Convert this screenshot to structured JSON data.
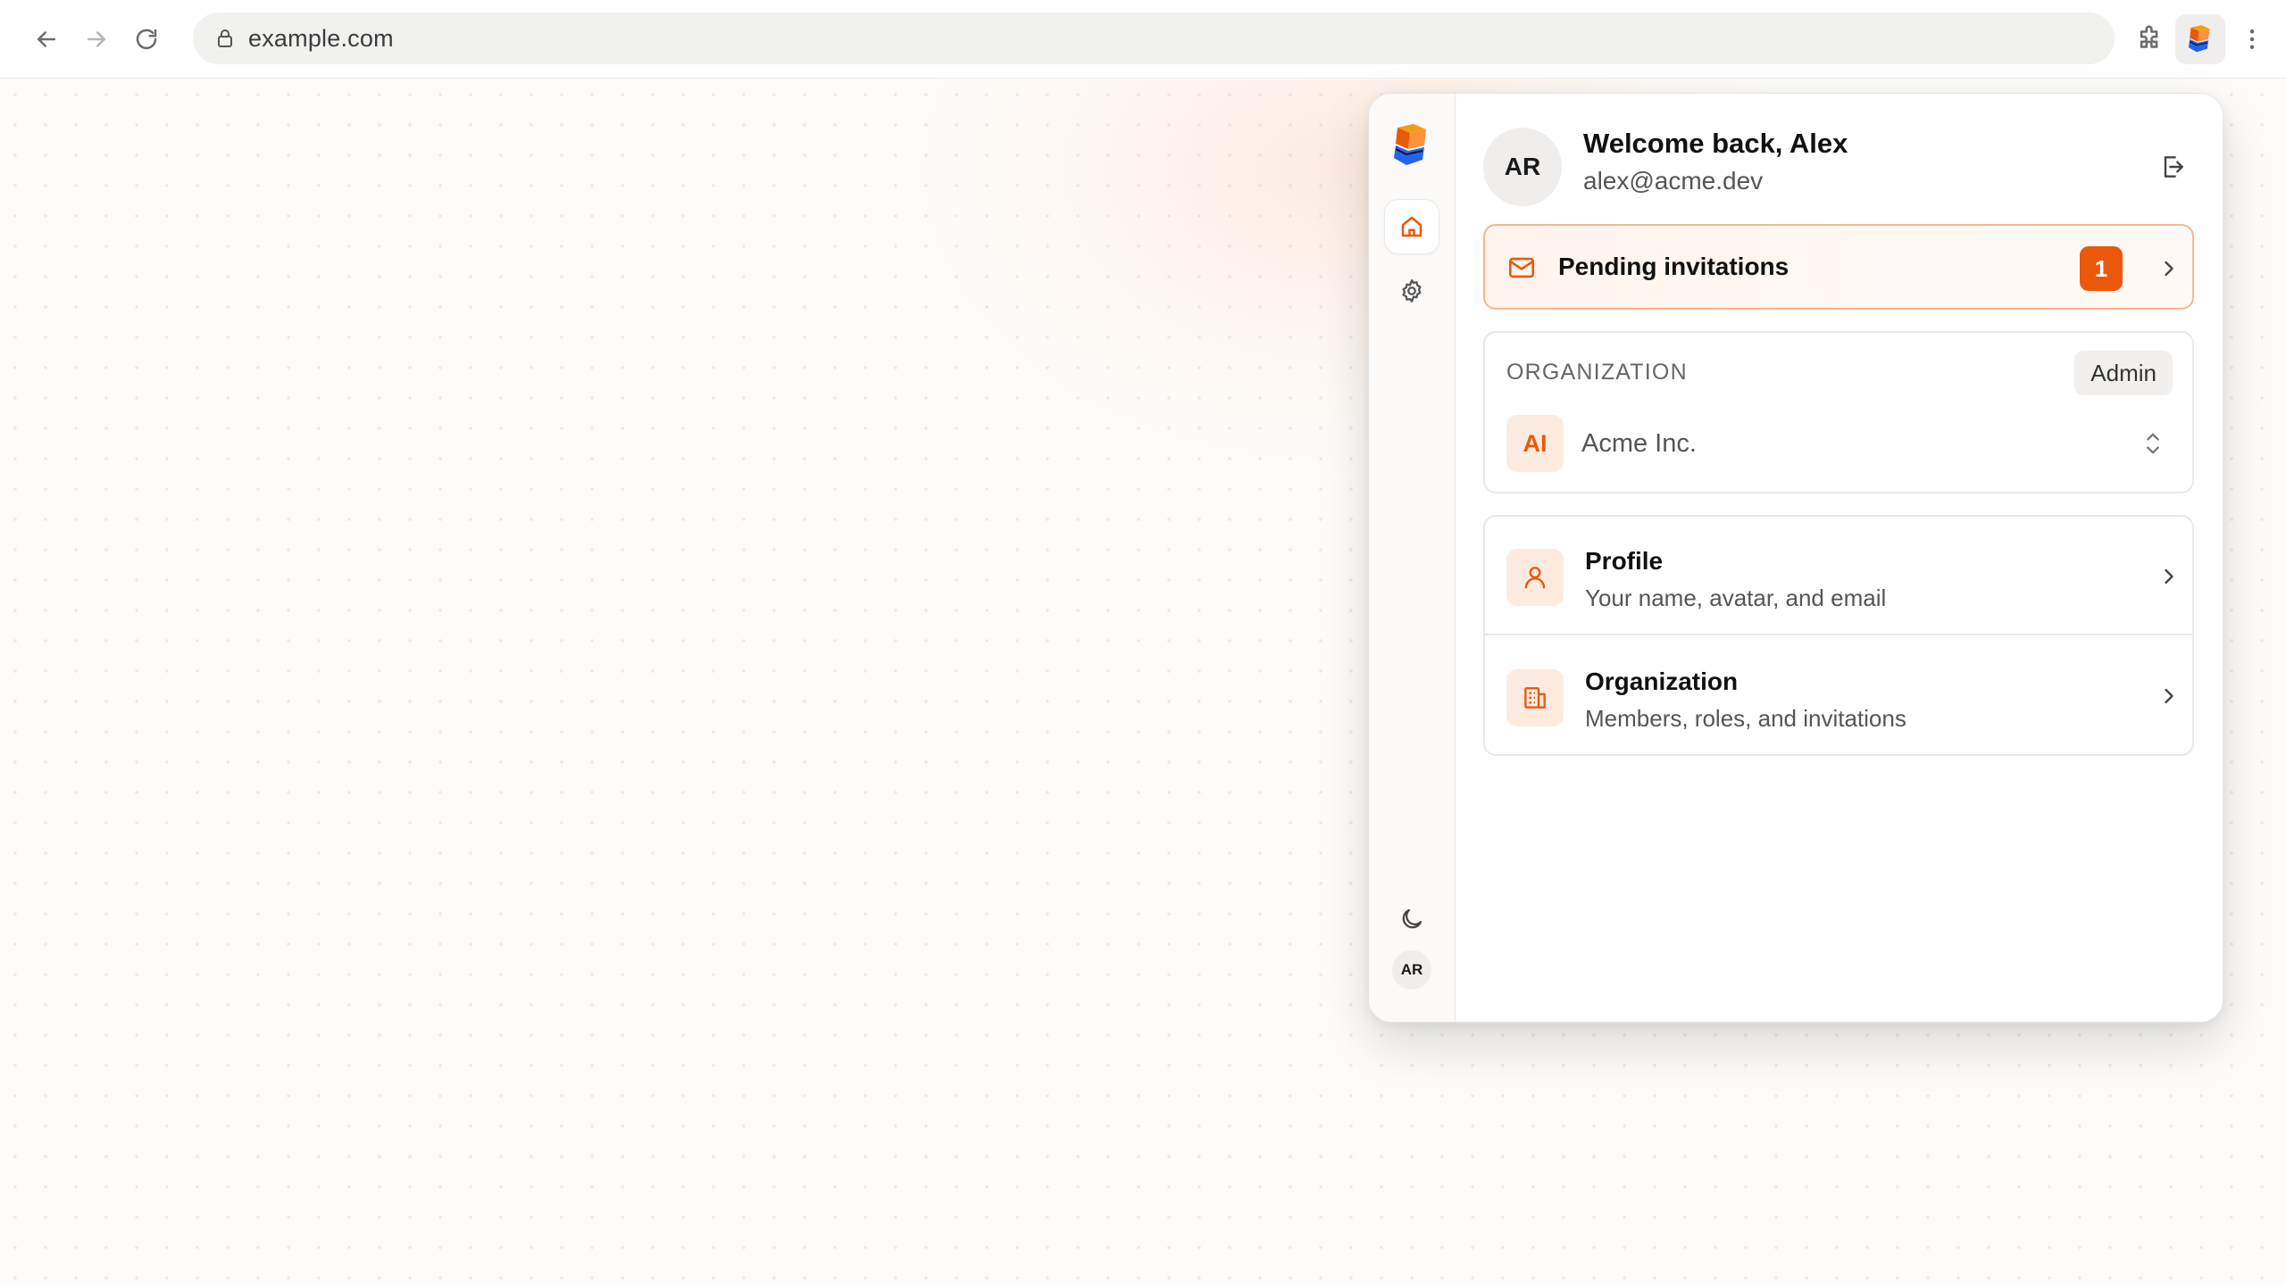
{
  "browser": {
    "url": "example.com",
    "back_icon": "arrow-left-icon",
    "forward_icon": "arrow-right-icon",
    "reload_icon": "reload-icon",
    "extensions_icon": "puzzle-icon",
    "menu_icon": "kebab-menu-icon"
  },
  "popup": {
    "user": {
      "initials": "AR",
      "welcome": "Welcome back, Alex",
      "email": "alex@acme.dev"
    },
    "invitations": {
      "label": "Pending invitations",
      "count": "1"
    },
    "organization": {
      "heading": "ORGANIZATION",
      "role": "Admin",
      "initials": "AI",
      "name": "Acme Inc."
    },
    "menu": [
      {
        "title": "Profile",
        "subtitle": "Your name, avatar, and email",
        "icon": "user-icon"
      },
      {
        "title": "Organization",
        "subtitle": "Members, roles, and invitations",
        "icon": "building-icon"
      }
    ],
    "rail": {
      "avatar_initials": "AR"
    }
  },
  "colors": {
    "accent": "#ea580c",
    "accent_soft": "#fdebe0",
    "invite_border": "#f6b78e"
  }
}
